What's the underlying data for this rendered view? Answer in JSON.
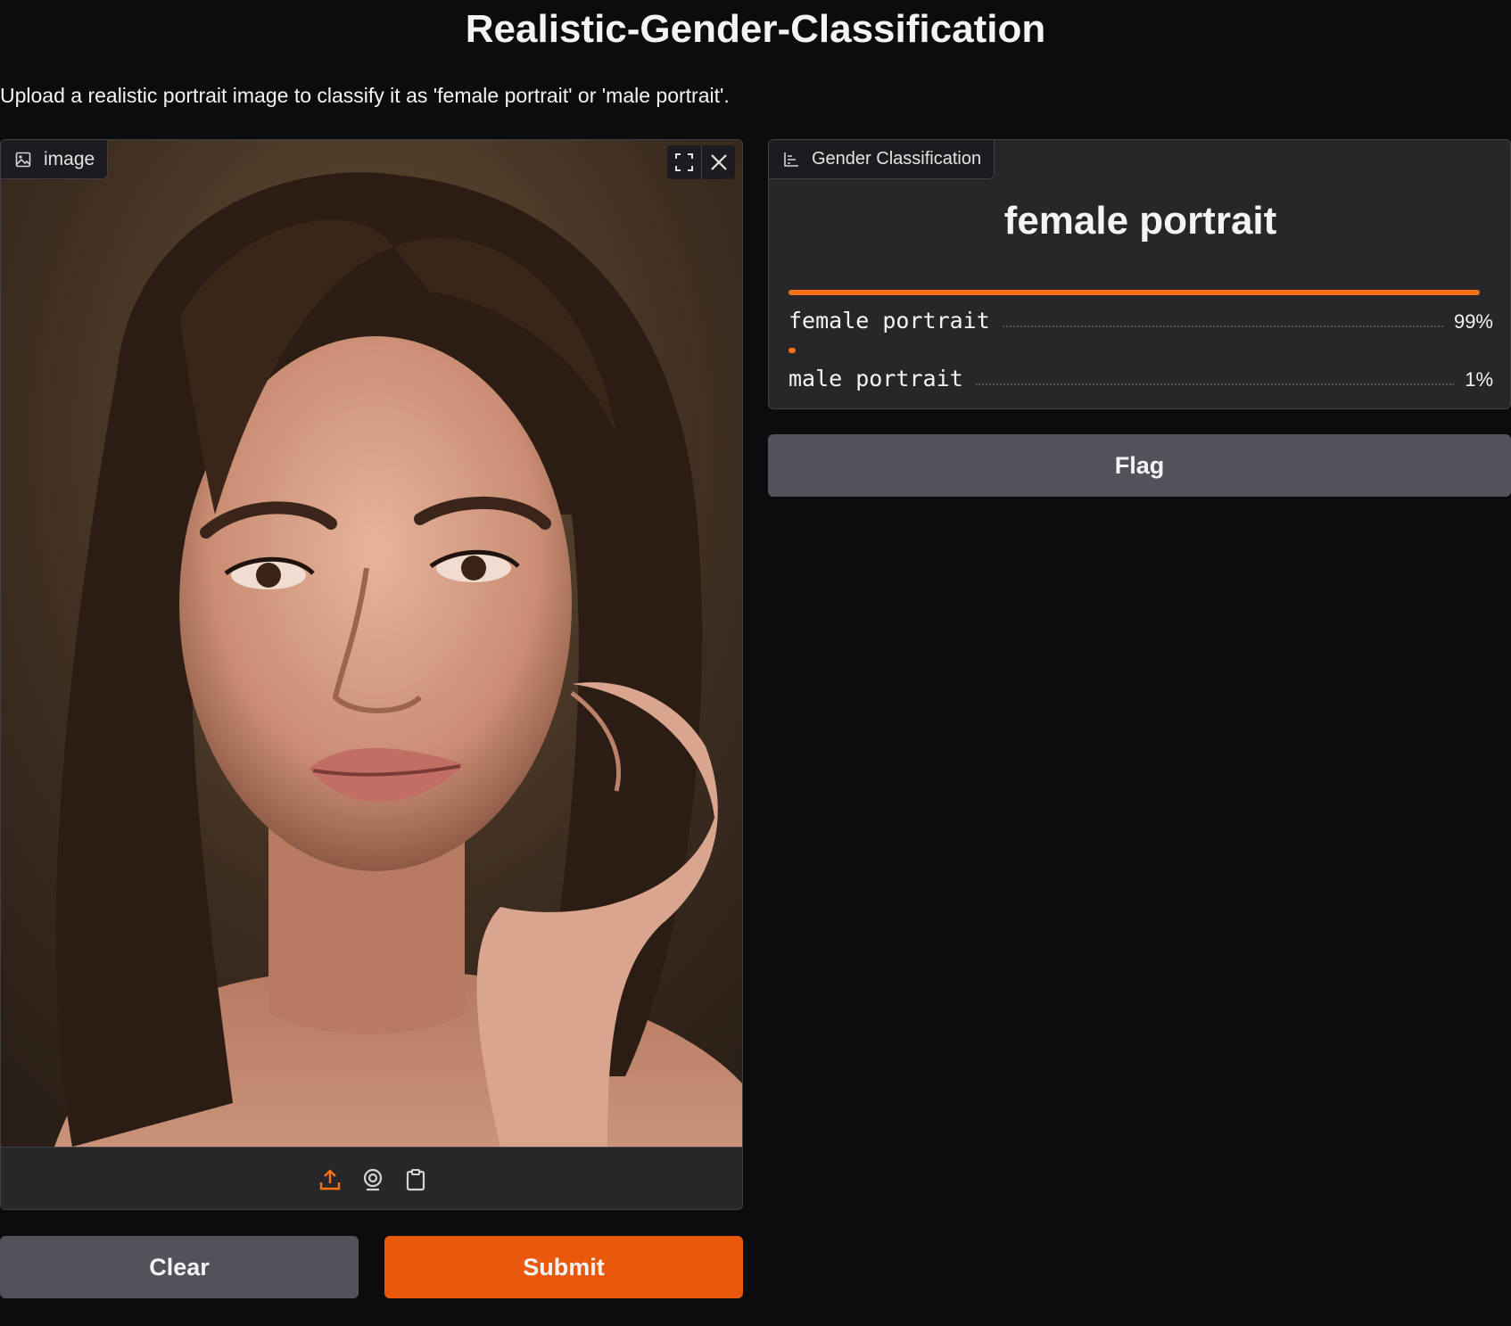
{
  "header": {
    "title": "Realistic-Gender-Classification",
    "description": "Upload a realistic portrait image to classify it as 'female portrait' or 'male portrait'."
  },
  "input_panel": {
    "label": "image",
    "label_icon": "image-icon",
    "actions": [
      "fullscreen-icon",
      "close-icon"
    ],
    "sources": [
      "upload-icon",
      "webcam-icon",
      "clipboard-icon"
    ]
  },
  "output_panel": {
    "label": "Gender Classification",
    "label_icon": "bar-chart-icon",
    "top_label": "female portrait",
    "confidences": [
      {
        "label": "female portrait",
        "percent": "99%",
        "value": 0.99
      },
      {
        "label": "male portrait",
        "percent": "1%",
        "value": 0.01
      }
    ]
  },
  "buttons": {
    "clear": "Clear",
    "submit": "Submit",
    "flag": "Flag"
  },
  "colors": {
    "accent": "#ea580c",
    "bar": "#f97316",
    "background": "#0c0c0f",
    "panel": "#27272a",
    "secondary_button": "#52525b"
  }
}
